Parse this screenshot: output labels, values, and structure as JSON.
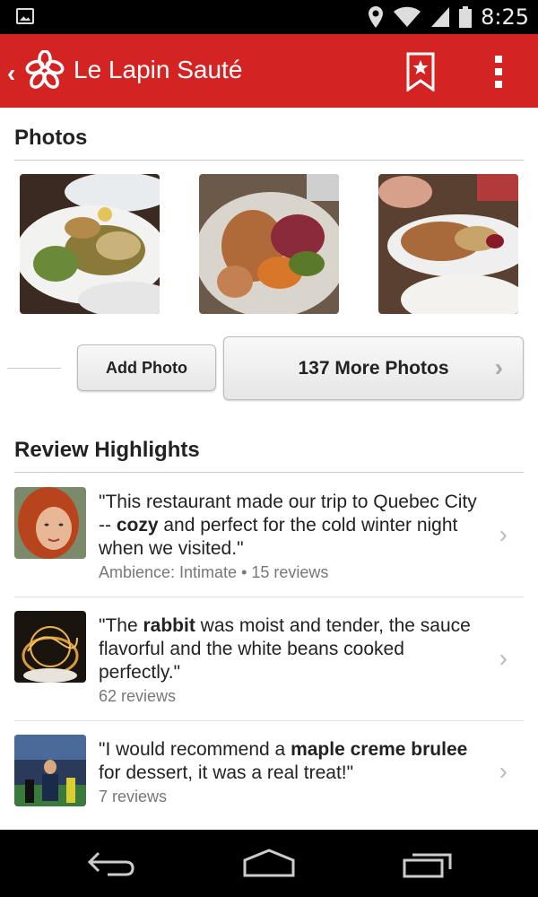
{
  "status_bar": {
    "time": "8:25"
  },
  "app_bar": {
    "title": "Le Lapin Sauté"
  },
  "photos": {
    "section_title": "Photos",
    "add_photo_label": "Add Photo",
    "more_photos_label": "137 More Photos"
  },
  "reviews": {
    "section_title": "Review Highlights",
    "items": [
      {
        "pre": "\"This restaurant made our trip to Quebec City -- ",
        "bold": "cozy",
        "post": " and perfect for the cold winter night when we visited.\"",
        "meta": "Ambience: Intimate • 15 reviews"
      },
      {
        "pre": "\"The ",
        "bold": "rabbit",
        "post": " was moist and tender, the sauce flavorful and the white beans cooked perfectly.\"",
        "meta": "62 reviews"
      },
      {
        "pre": "\"I would recommend a ",
        "bold": "maple creme brulee",
        "post": " for dessert, it was a real treat!\"",
        "meta": "7 reviews"
      }
    ]
  },
  "colors": {
    "brand_red": "#d32323"
  },
  "icons": [
    "picture-icon",
    "location-icon",
    "wifi-icon",
    "signal-icon",
    "battery-icon",
    "back-chevron-icon",
    "yelp-logo-icon",
    "bookmark-icon",
    "overflow-menu-icon",
    "chevron-right-icon",
    "nav-back-icon",
    "nav-home-icon",
    "nav-recents-icon"
  ]
}
